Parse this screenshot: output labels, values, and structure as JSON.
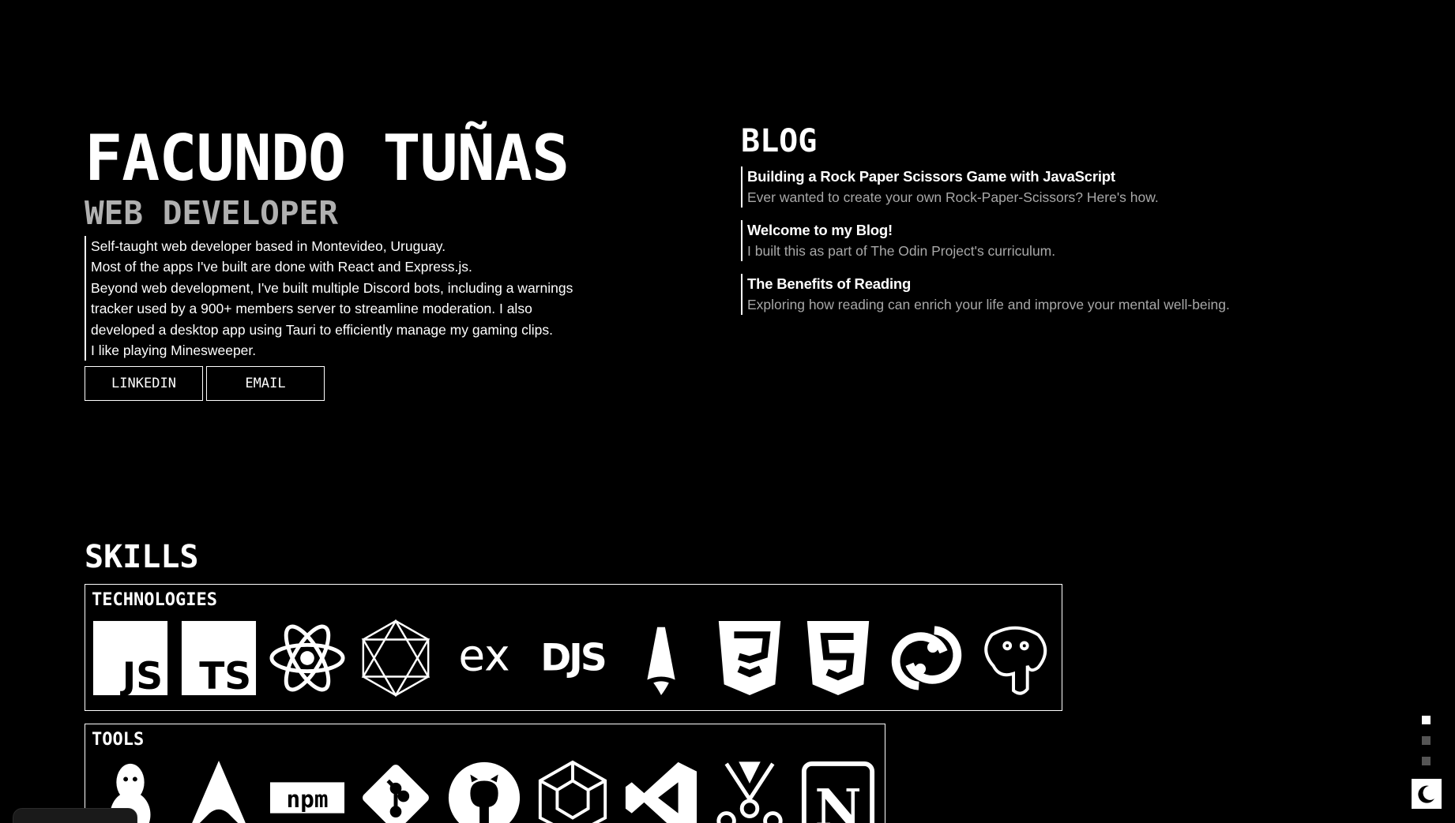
{
  "hero": {
    "name": "FACUNDO TUÑAS",
    "role": "WEB DEVELOPER",
    "bio": [
      "Self-taught web developer based in Montevideo, Uruguay.",
      "Most of the apps I've built are done with React and Express.js.",
      "Beyond web development, I've built multiple Discord bots, including a warnings tracker used by a 900+ members server to streamline moderation. I also developed a desktop app using Tauri to efficiently manage my gaming clips.",
      "I like playing Minesweeper."
    ],
    "links": {
      "linkedin": "LINKEDIN",
      "email": "EMAIL"
    }
  },
  "blog": {
    "title": "BLOG",
    "posts": [
      {
        "title": "Building a Rock Paper Scissors Game with JavaScript",
        "description": "Ever wanted to create your own Rock-Paper-Scissors? Here's how."
      },
      {
        "title": "Welcome to my Blog!",
        "description": "I built this as part of The Odin Project's curriculum."
      },
      {
        "title": "The Benefits of Reading",
        "description": "Exploring how reading can enrich your life and improve your mental well-being."
      }
    ]
  },
  "skills": {
    "title": "SKILLS",
    "technologies": {
      "label": "TECHNOLOGIES",
      "icons": [
        "javascript-icon",
        "typescript-icon",
        "react-icon",
        "webpack-icon",
        "express-icon",
        "discordjs-icon",
        "astro-icon",
        "css3-icon",
        "html5-icon",
        "tauri-icon",
        "postgresql-icon"
      ]
    },
    "tools": {
      "label": "TOOLS",
      "icons": [
        "linux-icon",
        "arch-linux-icon",
        "npm-icon",
        "git-icon",
        "github-icon",
        "webpack-cube-icon",
        "vscode-icon",
        "vitest-icon",
        "notion-icon"
      ]
    }
  },
  "nav": {
    "sections": [
      "hero",
      "skills",
      "projects"
    ],
    "active": 0
  },
  "theme": {
    "icon": "moon-icon"
  }
}
